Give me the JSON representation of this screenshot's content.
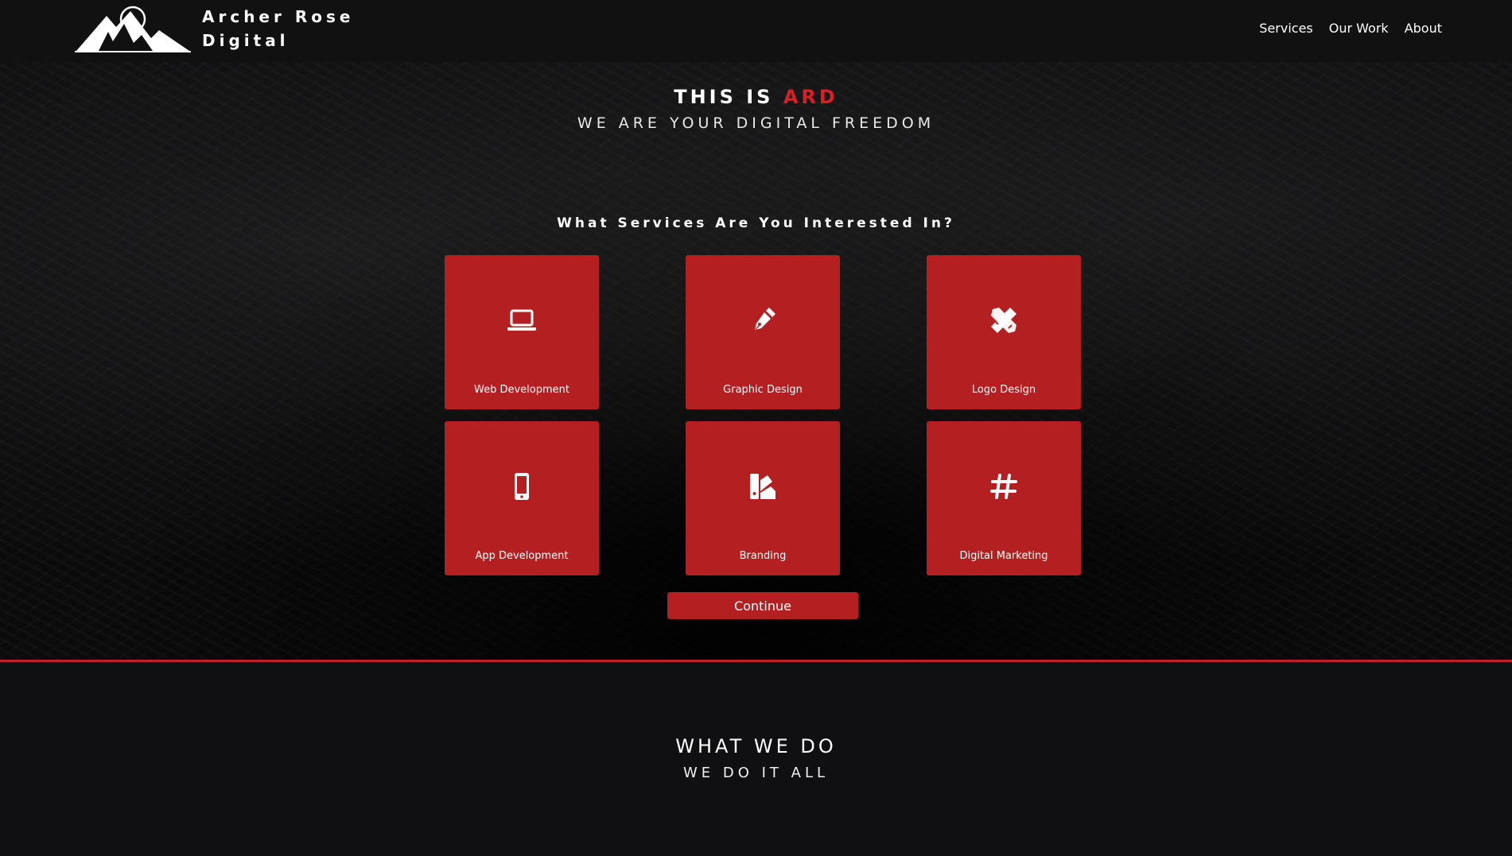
{
  "header": {
    "brand_line1": "Archer Rose",
    "brand_line2": "Digital",
    "nav": [
      "Services",
      "Our Work",
      "About"
    ]
  },
  "hero": {
    "title_prefix": "THIS IS ",
    "title_accent": "ARD",
    "subtitle": "WE ARE YOUR DIGITAL FREEDOM",
    "question": "What Services Are You Interested In?"
  },
  "services": [
    {
      "label": "Web Development",
      "icon": "laptop-icon"
    },
    {
      "label": "Graphic Design",
      "icon": "pen-nib-icon"
    },
    {
      "label": "Logo Design",
      "icon": "pencil-ruler-icon"
    },
    {
      "label": "App Development",
      "icon": "mobile-phone-icon"
    },
    {
      "label": "Branding",
      "icon": "swatchbook-icon"
    },
    {
      "label": "Digital Marketing",
      "icon": "hashtag-icon"
    }
  ],
  "continue_label": "Continue",
  "what_we_do": {
    "title": "WHAT WE DO",
    "subtitle": "WE DO IT ALL"
  },
  "colors": {
    "accent": "#d42126",
    "tile": "#b41f21",
    "background": "#101012"
  }
}
